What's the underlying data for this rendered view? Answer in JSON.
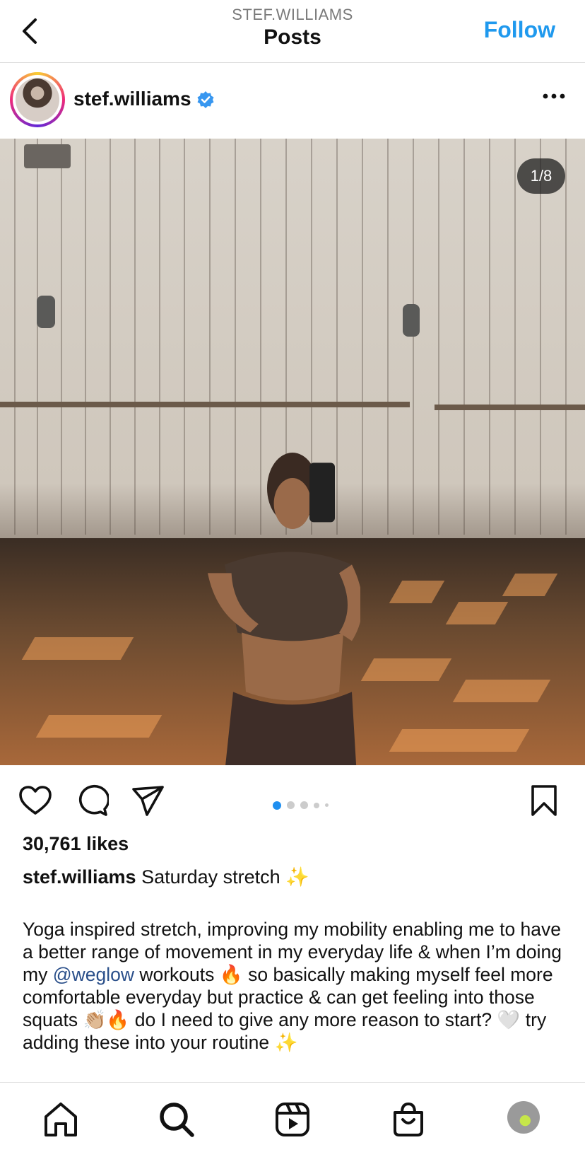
{
  "header": {
    "subtitle": "STEF.WILLIAMS",
    "title": "Posts",
    "follow_label": "Follow"
  },
  "post": {
    "username": "stef.williams",
    "image_counter": "1/8",
    "carousel": {
      "total_dots_visible": 5,
      "active_index": 0
    },
    "likes": "30,761 likes",
    "caption_username": "stef.williams",
    "caption_title": "Saturday stretch ✨",
    "caption_body_part1": "Yoga inspired stretch, improving my mobility enabling me to have a better range of movement in my everyday life & when I’m doing my ",
    "caption_mention": "@weglow",
    "caption_body_part2": " workouts 🔥 so basically making myself feel more comfortable everyday but practice & can get feeling into those squats 👏🏼🔥 do I need to give any more reason to start? 🤍 try adding these into your routine ✨"
  },
  "colors": {
    "accent": "#1f99ee",
    "carousel_active": "#1f8ff0",
    "verified": "#3897f0"
  },
  "icons": [
    "back-icon",
    "verified-icon",
    "more-icon",
    "heart-icon",
    "comment-icon",
    "share-icon",
    "bookmark-icon",
    "home-icon",
    "search-icon",
    "reels-icon",
    "shop-icon",
    "profile-avatar"
  ]
}
